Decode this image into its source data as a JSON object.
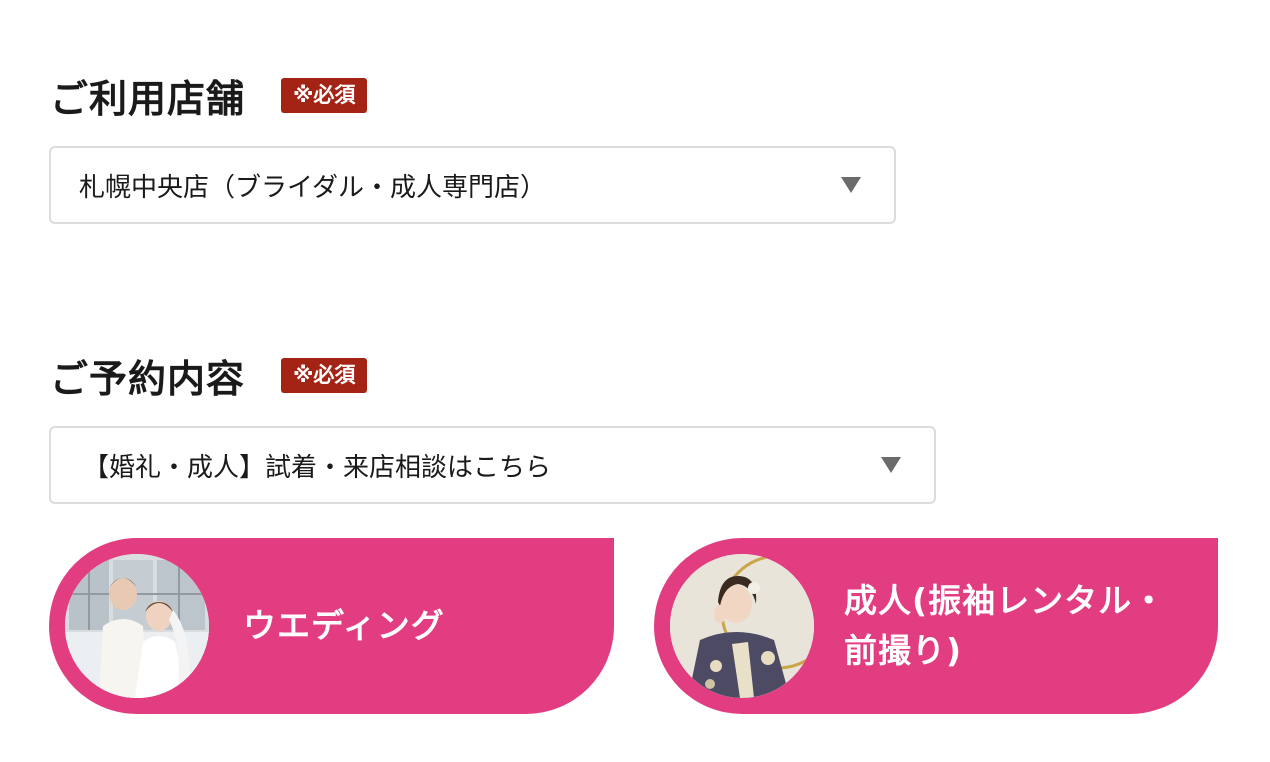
{
  "store_section": {
    "title": "ご利用店舗",
    "required_badge": "※必須",
    "selected_value": "札幌中央店（ブライダル・成人専門店）"
  },
  "content_section": {
    "title": "ご予約内容",
    "required_badge": "※必須",
    "selected_value": "【婚礼・成人】試着・来店相談はこちら"
  },
  "categories": [
    {
      "label": "ウエディング",
      "photo": "wedding-couple-photo"
    },
    {
      "label": "成人(振袖レンタル・前撮り)",
      "photo": "furisode-woman-photo"
    }
  ],
  "colors": {
    "badge_bg": "#a32315",
    "card_bg": "#e33d82",
    "select_border": "#dcdcdc",
    "arrow": "#6b6b6b"
  },
  "icons": {
    "select_arrow": "triangle-down-icon"
  }
}
